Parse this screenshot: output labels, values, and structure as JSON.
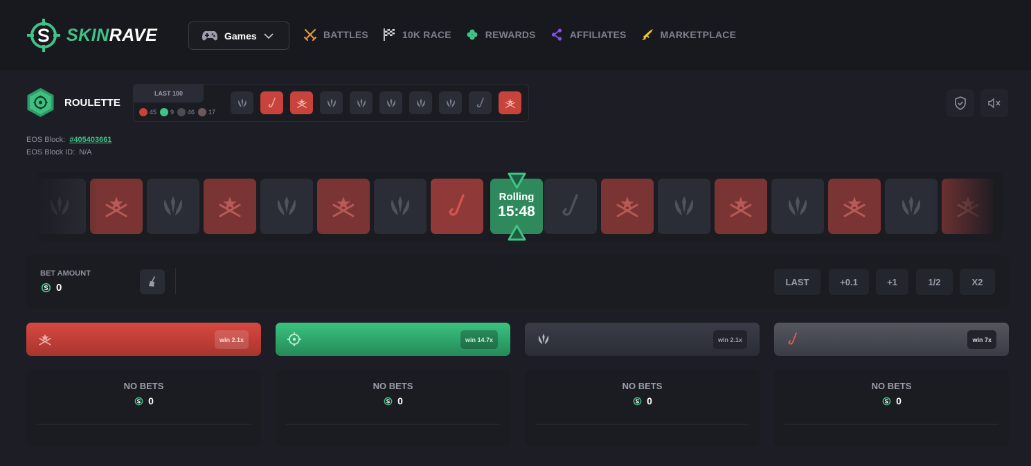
{
  "brand": {
    "name_part1": "SKIN",
    "name_part2": "RAVE",
    "accent": "#3ec486"
  },
  "header": {
    "games_label": "Games",
    "nav": [
      {
        "label": "BATTLES",
        "icon": "swords-icon",
        "color": "#e8963a"
      },
      {
        "label": "10K RACE",
        "icon": "checkered-flag-icon",
        "color": "#d8d8de"
      },
      {
        "label": "REWARDS",
        "icon": "clover-icon",
        "color": "#3ec486"
      },
      {
        "label": "AFFILIATES",
        "icon": "share-icon",
        "color": "#8a4df0"
      },
      {
        "label": "MARKETPLACE",
        "icon": "rifle-icon",
        "color": "#e8c23a"
      }
    ]
  },
  "game": {
    "title": "ROULETTE",
    "last_label": "LAST 100",
    "counts": {
      "t": "45",
      "green": "9",
      "ct": "46",
      "knife": "17"
    },
    "history": [
      "ct",
      "knife",
      "t",
      "ct",
      "ct",
      "ct",
      "ct",
      "ct",
      "knife-dark",
      "t"
    ]
  },
  "eos": {
    "block_label": "EOS Block:",
    "block_value": "#405403661",
    "block_id_label": "EOS Block ID:",
    "block_id_value": "N/A"
  },
  "roll": {
    "status": "Rolling",
    "timer": "15:48",
    "strip": [
      "ct",
      "t",
      "ct",
      "t",
      "ct",
      "t",
      "ct",
      "knife",
      "center",
      "knife-dark",
      "t",
      "ct",
      "t",
      "ct",
      "t",
      "ct",
      "t"
    ]
  },
  "bet": {
    "label": "BET AMOUNT",
    "value": "0",
    "quick": [
      "LAST",
      "+0.1",
      "+1",
      "1/2",
      "X2"
    ]
  },
  "columns": [
    {
      "type": "red",
      "win": "win 2.1x",
      "no_bets": "NO BETS",
      "total": "0"
    },
    {
      "type": "green",
      "win": "win 14.7x",
      "no_bets": "NO BETS",
      "total": "0"
    },
    {
      "type": "ct",
      "win": "win 2.1x",
      "no_bets": "NO BETS",
      "total": "0"
    },
    {
      "type": "knife",
      "win": "win 7x",
      "no_bets": "NO BETS",
      "total": "0"
    }
  ]
}
